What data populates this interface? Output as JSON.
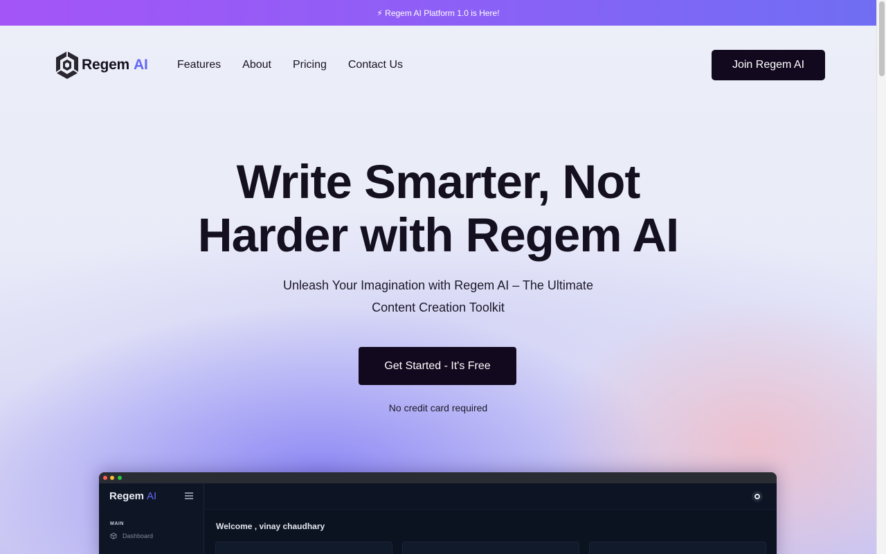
{
  "announcement": {
    "text": "⚡ Regem AI Platform 1.0 is Here!"
  },
  "brand": {
    "name": "Regem",
    "suffix": "AI",
    "icon": "hexagon-cube-logo-icon",
    "accent_color": "#6366f1"
  },
  "nav": {
    "links": [
      "Features",
      "About",
      "Pricing",
      "Contact Us"
    ],
    "join_button": "Join Regem AI"
  },
  "hero": {
    "headline_line1": "Write Smarter, Not",
    "headline_line2": "Harder with Regem AI",
    "subtitle_line1": "Unleash Your Imagination with Regem AI – The Ultimate",
    "subtitle_line2": "Content Creation Toolkit",
    "cta_label": "Get Started - It's Free",
    "note": "No credit card required"
  },
  "preview": {
    "logo_name": "Regem",
    "logo_suffix": "AI",
    "menu_icon": "hamburger-menu-icon",
    "section_label": "MAIN",
    "dashboard_item": "Dashboard",
    "dashboard_icon": "cube-icon",
    "welcome_text": "Welcome , vinay chaudhary",
    "avatar_icon": "user-avatar-icon"
  },
  "colors": {
    "primary_dark": "#13091f",
    "banner_gradient_start": "#a455f7",
    "banner_gradient_end": "#6f6ef3"
  }
}
